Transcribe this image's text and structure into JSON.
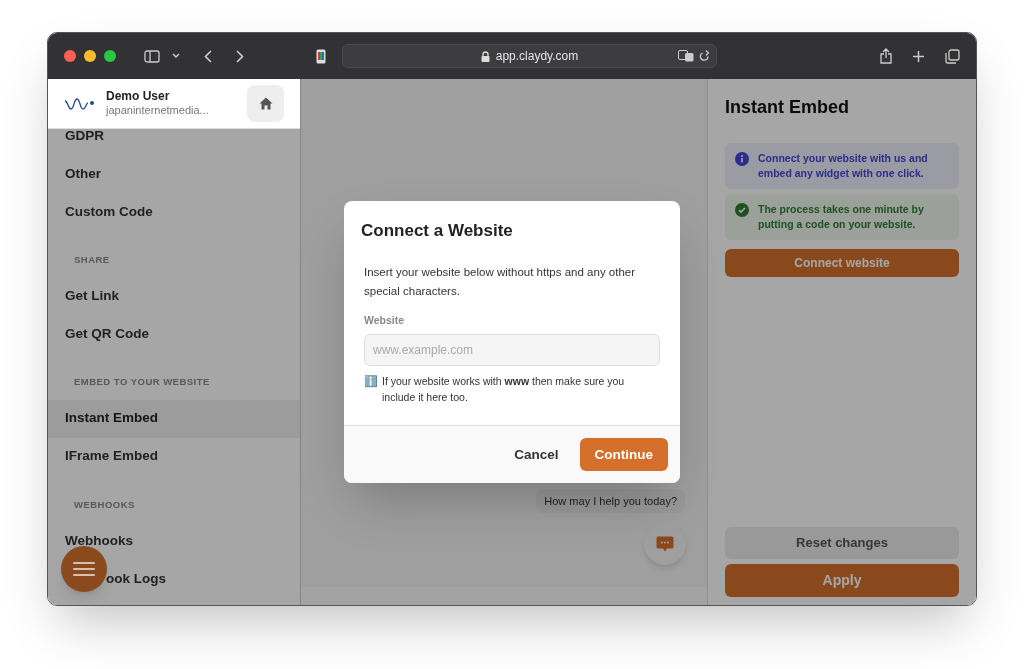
{
  "browser": {
    "url": "app.claydy.com"
  },
  "sidebar": {
    "user": {
      "name": "Demo User",
      "email": "japaninternetmedia..."
    },
    "items": [
      {
        "kind": "item",
        "label": "GDPR"
      },
      {
        "kind": "item",
        "label": "Other",
        "selected": false
      },
      {
        "kind": "item",
        "label": "Custom Code",
        "selected": false
      },
      {
        "kind": "heading",
        "label": "SHARE"
      },
      {
        "kind": "item",
        "label": "Get Link",
        "selected": false
      },
      {
        "kind": "item",
        "label": "Get QR Code",
        "selected": false
      },
      {
        "kind": "heading",
        "label": "EMBED TO YOUR WEBSITE"
      },
      {
        "kind": "item",
        "label": "Instant Embed",
        "selected": true
      },
      {
        "kind": "item",
        "label": "IFrame Embed",
        "selected": false
      },
      {
        "kind": "heading",
        "label": "WEBHOOKS"
      },
      {
        "kind": "item",
        "label": "Webhooks",
        "selected": false
      },
      {
        "kind": "covered_item",
        "label": "ook Logs"
      }
    ]
  },
  "preview": {
    "chat_bubble": "How may I help you today?"
  },
  "panel": {
    "title": "Instant Embed",
    "notices": [
      {
        "kind": "info",
        "text": "Connect your website with us and embed any widget with one click."
      },
      {
        "kind": "success",
        "text": "The process takes one minute by putting a code on your website."
      }
    ],
    "connect_button": "Connect website",
    "reset_button": "Reset changes",
    "apply_button": "Apply"
  },
  "dialog": {
    "title": "Connect a Website",
    "description": "Insert your website below without https and any other special characters.",
    "field_label": "Website",
    "placeholder": "www.example.com",
    "hint_icon": "ℹ️",
    "hint": "If your website works with **www** then make sure you include it here too.",
    "buttons": [
      "Cancel",
      "Continue"
    ]
  }
}
